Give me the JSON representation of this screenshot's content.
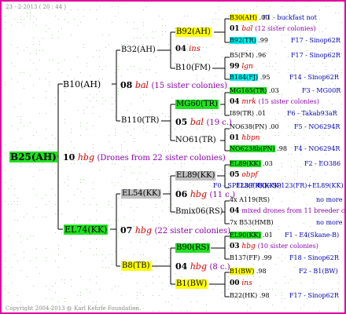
{
  "header": "23 - 2-2013 ( 20 : 44 )",
  "footer": "Copyright 2004-2013 @ Karl Kehrle Foundation.",
  "root": {
    "name": "B25(AH)"
  },
  "sire": {
    "name": "B10(AH)",
    "num": "10",
    "ins": "hbg",
    "note": "(Drones from 22 sister colonies)"
  },
  "dam": {
    "name": "EL74(KK)",
    "num": "07",
    "ins": "hbg",
    "note": "(22 sister colonies)"
  },
  "b32": {
    "name": "B32(AH)"
  },
  "g08": {
    "num": "08",
    "ins": "bal",
    "note": "(15 sister colonies)"
  },
  "b110": {
    "name": "B110(TR)"
  },
  "el54": {
    "name": "EL54(KK)"
  },
  "g06": {
    "num": "06",
    "ins": "hbg",
    "note": "(11 c.)"
  },
  "b8": {
    "name": "B8(TB)"
  },
  "b92": {
    "name": "B92(AH)"
  },
  "g04a": {
    "num": "04",
    "ins": "ins"
  },
  "b10fm": {
    "name": "B10(FM)"
  },
  "mg60": {
    "name": "MG60(TR)"
  },
  "g05": {
    "num": "05",
    "ins": "bal",
    "note": "(19 c.)"
  },
  "no61": {
    "name": "NO61(TR)"
  },
  "el89": {
    "name": "EL89(KK)"
  },
  "bmix": {
    "name": "Bmix06(RS)"
  },
  "b90": {
    "name": "B90(RS)"
  },
  "g04b": {
    "num": "04",
    "ins": "hbg",
    "note": "(8 c.)"
  },
  "b1bw": {
    "name": "B1(BW)"
  },
  "right": {
    "r1_name": "B30(AH)",
    "r1_val": ".00",
    "r1_right": "F1 - buckfast not",
    "r2_num": "01",
    "r2_ins": "bal",
    "r2_note": "(12 sister colonies)",
    "r3_name": "B92(TR)",
    "r3_val": ".99",
    "r3_right": "F17 - Sinop62R",
    "r4_name": "B5(FM)",
    "r4_val": ".96",
    "r4_right": "F17 - Sinop62R",
    "r5_num": "99",
    "r5_ins": "lgn",
    "r6_name": "B184(FJ)",
    "r6_val": ".95",
    "r6_right": "F14 - Sinop62R",
    "r7_name": "MG165(TR)",
    "r7_val": ".03",
    "r7_right": "F3 - MG00R",
    "r8_num": "04",
    "r8_ins": "mrk",
    "r8_note": "(15 sister colonies)",
    "r9_name": "I89(TR)",
    "r9_val": ".01",
    "r9_right": "F6 - Takab93aR",
    "r10_name": "NO638(PN)",
    "r10_val": ".00",
    "r10_right": "F5 - NO6294R",
    "r11_num": "01",
    "r11_ins": "hbpn",
    "r12_name": "NO6238b(PN)",
    "r12_val": ".98",
    "r12_right": "F4 - NO6294R",
    "r13_name": "EL89(KK)",
    "r13_val": ".03",
    "r13_right": "F2 - EO386",
    "r14_num": "05",
    "r14_ins": "obpf",
    "r15_a": "F0 - SP123(FR)(KK)",
    "r15_b": "EL89(KK)(KK)",
    "r15_c": "F0 - SP123(FR)+EL89(KK)",
    "r16_name": "4x A119(RS)",
    "r16_right": "no more",
    "r17_num": "04",
    "r17_text": "mixed drones from 11 breeder colo",
    "r18_name": "7x B53(HMB)",
    "r18_right": "no more",
    "r19_name": "EL90(KK)",
    "r19_val": ".01",
    "r19_right": "F1 - E4(Skane-B)",
    "r20_num": "03",
    "r20_ins": "hbg",
    "r20_note": "(10 sister colonies)",
    "r21_name": "B137(FF)",
    "r21_val": ".99",
    "r21_right": "F18 - Sinop62R",
    "r22_name": "B1(BW)",
    "r22_val": ".98",
    "r22_right": "F2 - B1(BW)",
    "r23_num": "00",
    "r23_ins": "ins",
    "r24_name": "B22(HK)",
    "r24_val": ".98",
    "r24_right": "F17 - Sinop62R"
  }
}
